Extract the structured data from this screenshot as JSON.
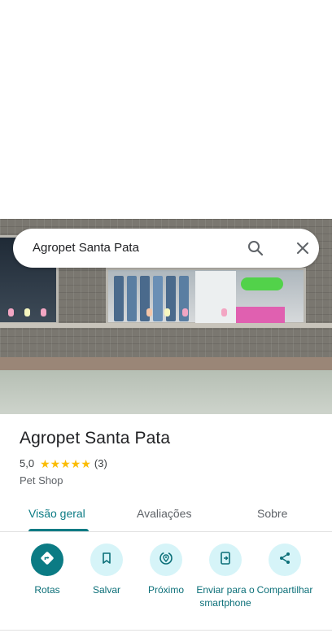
{
  "search": {
    "query": "Agropet Santa Pata"
  },
  "place": {
    "name": "Agropet Santa Pata",
    "rating": "5,0",
    "stars": 5,
    "review_count": "(3)",
    "category": "Pet Shop"
  },
  "tabs": [
    {
      "label": "Visão geral",
      "active": true
    },
    {
      "label": "Avaliações",
      "active": false
    },
    {
      "label": "Sobre",
      "active": false
    }
  ],
  "actions": [
    {
      "label": "Rotas",
      "icon": "directions-icon"
    },
    {
      "label": "Salvar",
      "icon": "bookmark-icon"
    },
    {
      "label": "Próximo",
      "icon": "nearby-icon"
    },
    {
      "label": "Enviar para o smartphone",
      "icon": "send-to-phone-icon"
    },
    {
      "label": "Compartilhar",
      "icon": "share-icon"
    }
  ],
  "colors": {
    "accent": "#0b7b84",
    "chip": "#d6f4f8",
    "star": "#fbbc04"
  },
  "photo": {
    "subject": "storefront-street-view-photo"
  }
}
